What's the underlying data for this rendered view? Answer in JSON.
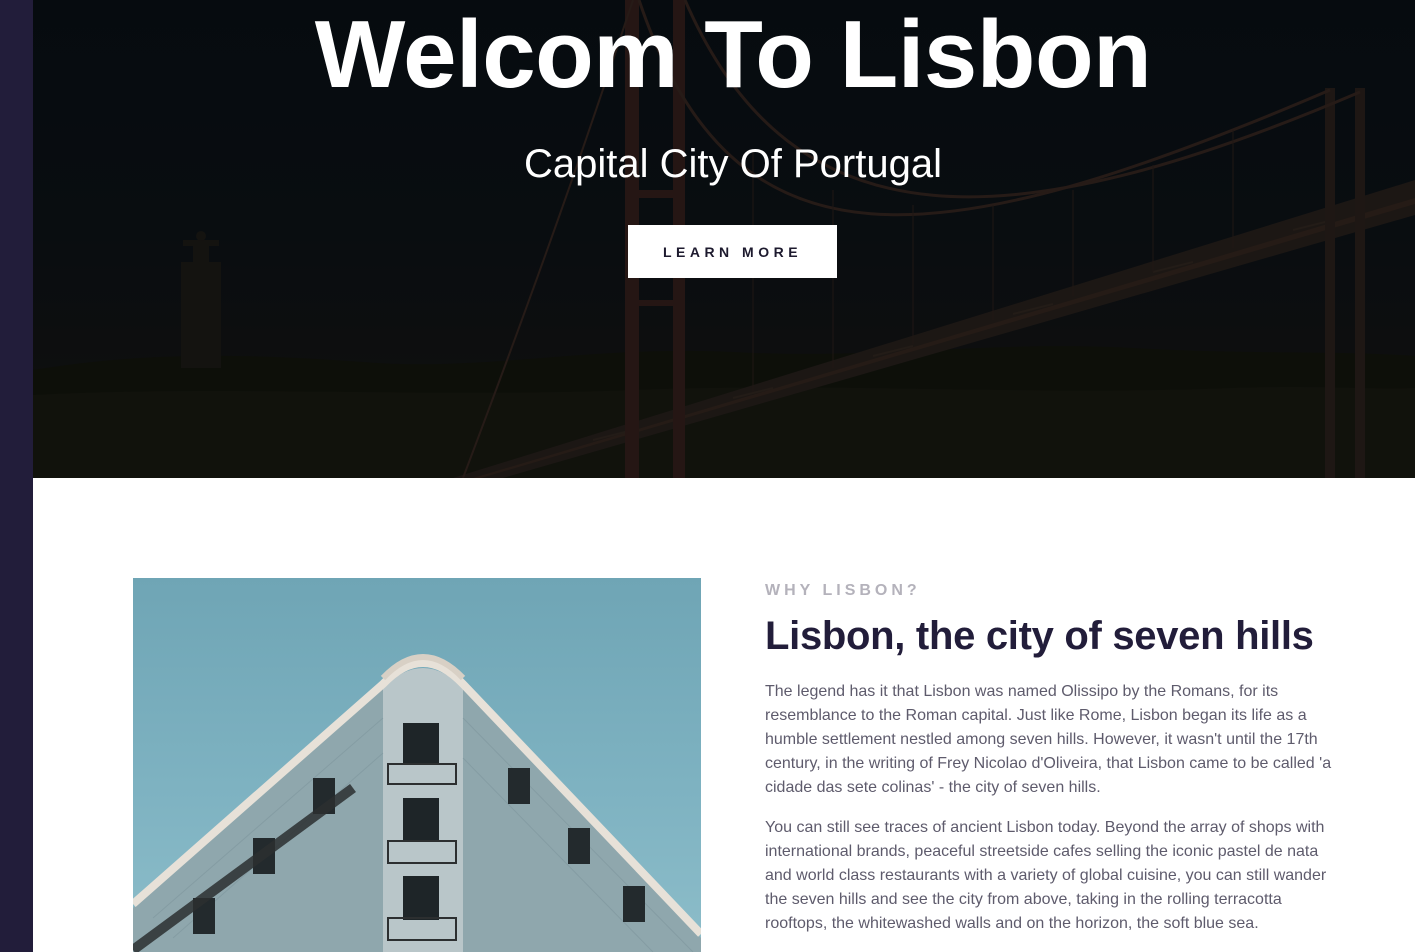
{
  "hero": {
    "title": "Welcom To Lisbon",
    "subtitle": "Capital City Of Portugal",
    "button_label": "LEARN MORE"
  },
  "about": {
    "eyebrow": "WHY LISBON?",
    "heading": "Lisbon, the city of seven hills",
    "paragraphs": [
      "The legend has it that Lisbon was named Olissipo by the Romans, for its resemblance to the Roman capital. Just like Rome, Lisbon began its life as a humble settlement nestled among seven hills. However, it wasn't until the 17th century, in the writing of Frey Nicolao d'Oliveira, that Lisbon came to be called 'a cidade das sete colinas' - the city of seven hills.",
      "You can still see traces of ancient Lisbon today. Beyond the array of shops with international brands, peaceful streetside cafes selling the iconic pastel de nata and world class restaurants with a variety of global cuisine, you can still wander the seven hills and see the city from above, taking in the rolling terracotta rooftops, the whitewashed walls and on the horizon, the soft blue sea."
    ]
  },
  "colors": {
    "sidebar": "#221d3a",
    "heading": "#221d3a",
    "body_text": "#5e5b6c",
    "eyebrow": "#b4b2bb"
  }
}
